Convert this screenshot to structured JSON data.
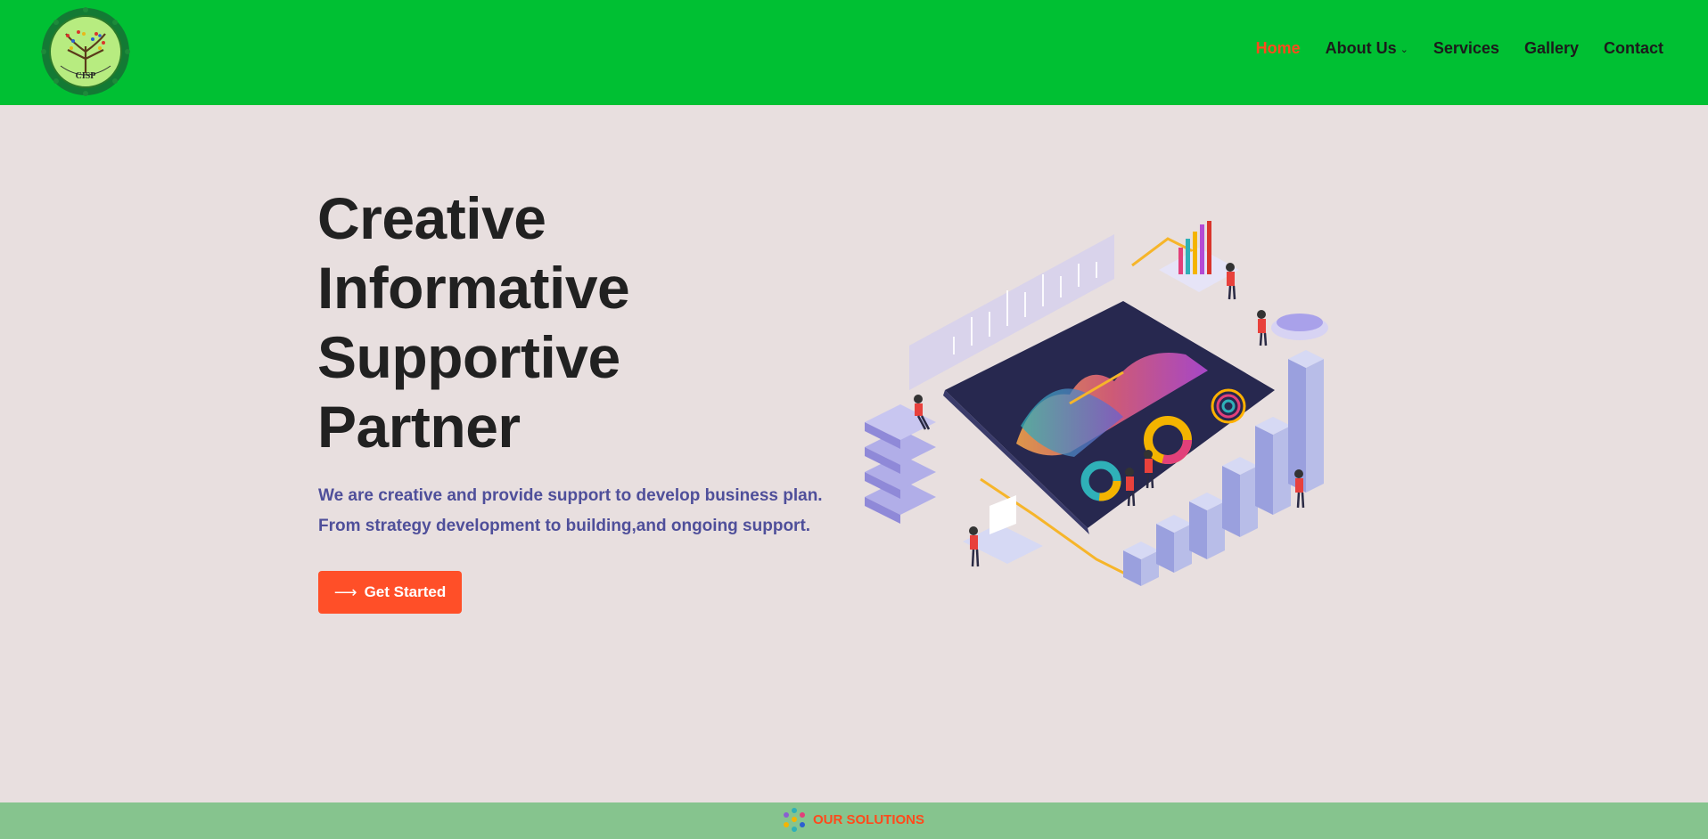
{
  "header": {
    "logo_text": "CISP",
    "nav": [
      {
        "label": "Home",
        "active": true
      },
      {
        "label": "About Us",
        "dropdown": true
      },
      {
        "label": "Services"
      },
      {
        "label": "Gallery"
      },
      {
        "label": "Contact"
      }
    ]
  },
  "hero": {
    "title_lines": [
      "Creative",
      "Informative",
      "Supportive",
      "Partner"
    ],
    "text_lines": [
      "We are creative and provide support to develop business plan.",
      "From strategy development to building,and ongoing support."
    ],
    "cta_label": "Get Started"
  },
  "solutions": {
    "label": "OUR SOLUTIONS"
  },
  "colors": {
    "header_bg": "#00c033",
    "page_bg": "#e8dfdf",
    "accent": "#ff4f28",
    "text_purple": "#4f4f9a",
    "solutions_bar": "#86c48e"
  }
}
